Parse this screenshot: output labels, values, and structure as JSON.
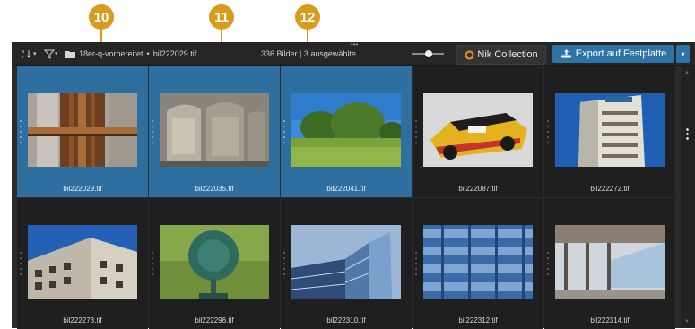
{
  "callouts": [
    "10",
    "11",
    "12"
  ],
  "toolbar": {
    "path_folder": "18er-q-vorbereitet",
    "separator": "•",
    "path_file": "bil222029.tif",
    "status": "336 Bilder | 3 ausgewählte",
    "nik_label": "Nik Collection",
    "export_label": "Export auf Festplatte"
  },
  "grid": [
    {
      "file": "bil222029.tif",
      "selected": true
    },
    {
      "file": "bil222035.tif",
      "selected": true
    },
    {
      "file": "bil222041.tif",
      "selected": true
    },
    {
      "file": "bil222087.tif",
      "selected": false
    },
    {
      "file": "bil222272.tif",
      "selected": false
    },
    {
      "file": "bil222278.tif",
      "selected": false
    },
    {
      "file": "bil222296.tif",
      "selected": false
    },
    {
      "file": "bil222310.tif",
      "selected": false
    },
    {
      "file": "bil222312.tif",
      "selected": false
    },
    {
      "file": "bil222314.tif",
      "selected": false
    }
  ],
  "colors": {
    "accent": "#d99a1e",
    "selection": "#2f6fa0",
    "export_button": "#2e73a8"
  }
}
